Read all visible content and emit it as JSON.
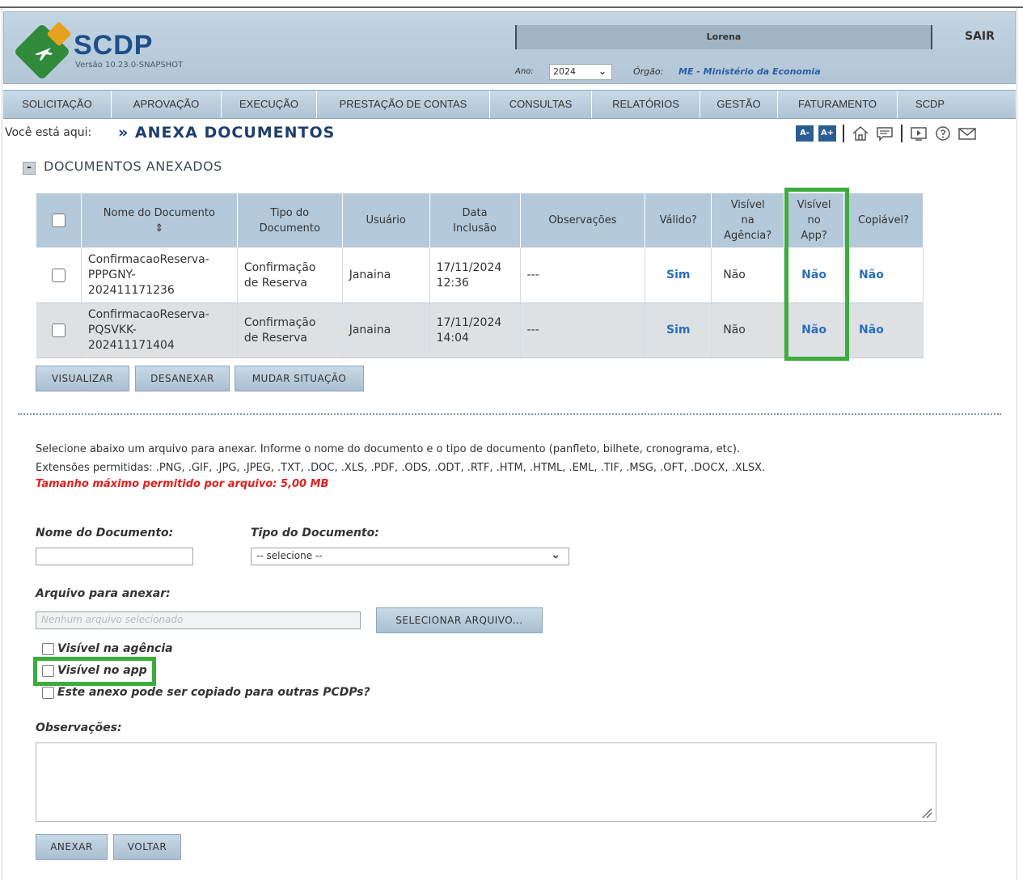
{
  "header": {
    "brand": "SCDP",
    "version": "Versão 10.23.0-SNAPSHOT",
    "user_name": "Lorena",
    "logout_label": "SAIR",
    "year_label": "Ano:",
    "year_value": "2024",
    "org_label": "Órgão:",
    "org_value": "ME - Ministério da Economia"
  },
  "nav": {
    "items": [
      {
        "label": "SOLICITAÇÃO"
      },
      {
        "label": "APROVAÇÃO"
      },
      {
        "label": "EXECUÇÃO"
      },
      {
        "label": "PRESTAÇÃO DE CONTAS"
      },
      {
        "label": "CONSULTAS"
      },
      {
        "label": "RELATÓRIOS"
      },
      {
        "label": "GESTÃO"
      },
      {
        "label": "FATURAMENTO"
      },
      {
        "label": "SCDP"
      }
    ]
  },
  "breadcrumb": {
    "prefix": "Você está aqui:",
    "current": "ANEXA DOCUMENTOS"
  },
  "toolbar": {
    "font_decrease": "A-",
    "font_increase": "A+"
  },
  "section": {
    "collapse_symbol": "-",
    "title": "DOCUMENTOS ANEXADOS"
  },
  "table": {
    "headers": {
      "nome": "Nome do Documento",
      "sort_symbol": "⇕",
      "tipo_1": "Tipo do",
      "tipo_2": "Documento",
      "usuario": "Usuário",
      "data_1": "Data",
      "data_2": "Inclusão",
      "obs": "Observações",
      "valido": "Válido?",
      "vis_ag_1": "Visível",
      "vis_ag_2": "na",
      "vis_ag_3": "Agência?",
      "vis_app_1": "Visível",
      "vis_app_2": "no",
      "vis_app_3": "App?",
      "copiavel": "Copiável?"
    },
    "rows": [
      {
        "nome_1": "ConfirmacaoReserva-",
        "nome_2": "PPPGNY-",
        "nome_3": "202411171236",
        "tipo_1": "Confirmação",
        "tipo_2": "de Reserva",
        "usuario": "Janaina",
        "data_1": "17/11/2024",
        "data_2": "12:36",
        "obs": "---",
        "valido": "Sim",
        "vis_agencia": "Não",
        "vis_app": "Não",
        "copiavel": "Não"
      },
      {
        "nome_1": "ConfirmacaoReserva-",
        "nome_2": "PQSVKK-",
        "nome_3": "202411171404",
        "tipo_1": "Confirmação",
        "tipo_2": "de Reserva",
        "usuario": "Janaina",
        "data_1": "17/11/2024",
        "data_2": "14:04",
        "obs": "---",
        "valido": "Sim",
        "vis_agencia": "Não",
        "vis_app": "Não",
        "copiavel": "Não"
      }
    ]
  },
  "actions": {
    "visualizar": "VISUALIZAR",
    "desanexar": "DESANEXAR",
    "mudar_situacao": "MUDAR SITUAÇÃO"
  },
  "upload": {
    "info_line_1": "Selecione abaixo um arquivo para anexar. Informe o nome do documento e o tipo de documento (panfleto, bilhete, cronograma, etc).",
    "info_line_2": "Extensões permitidas: .PNG, .GIF, .JPG, .JPEG, .TXT, .DOC, .XLS, .PDF, .ODS, .ODT, .RTF, .HTM, .HTML, .EML, .TIF, .MSG, .OFT, .DOCX, .XLSX.",
    "max_size": "Tamanho máximo permitido por arquivo: 5,00 MB",
    "nome_label": "Nome do Documento:",
    "nome_value": "",
    "tipo_label": "Tipo do Documento:",
    "tipo_selected": "-- selecione --",
    "arquivo_label": "Arquivo para anexar:",
    "arquivo_placeholder": "Nenhum arquivo selecionado",
    "select_file_button": "SELECIONAR ARQUIVO...",
    "check_agencia": "Visível na agência",
    "check_app": "Visível no app",
    "check_copiar": "Este anexo pode ser copiado para outras PCDPs?",
    "obs_label": "Observações:",
    "anexar_button": "ANEXAR",
    "voltar_button": "VOLTAR"
  },
  "colors": {
    "highlight": "#3cad3c",
    "link_blue": "#2a6fb8",
    "warning_red": "#e02020",
    "header_bg": "#b4c9d9"
  }
}
